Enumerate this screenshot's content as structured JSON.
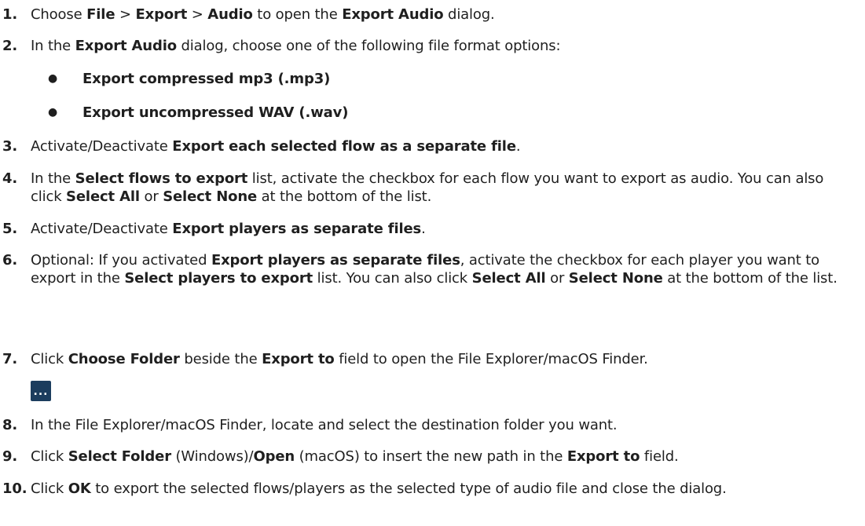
{
  "steps": [
    {
      "num": "1.",
      "segments": [
        {
          "t": "Choose "
        },
        {
          "t": "File",
          "b": true
        },
        {
          "t": " > "
        },
        {
          "t": "Export",
          "b": true
        },
        {
          "t": " > "
        },
        {
          "t": "Audio",
          "b": true
        },
        {
          "t": " to open the "
        },
        {
          "t": "Export Audio",
          "b": true
        },
        {
          "t": " dialog."
        }
      ]
    },
    {
      "num": "2.",
      "segments": [
        {
          "t": "In the "
        },
        {
          "t": "Export Audio",
          "b": true
        },
        {
          "t": " dialog, choose one of the following file format options:"
        }
      ]
    },
    {
      "num": "3.",
      "segments": [
        {
          "t": "Activate/Deactivate "
        },
        {
          "t": "Export each selected flow as a separate file",
          "b": true
        },
        {
          "t": "."
        }
      ]
    },
    {
      "num": "4.",
      "segments": [
        {
          "t": "In the "
        },
        {
          "t": "Select flows to export",
          "b": true
        },
        {
          "t": " list, activate the checkbox for each flow you want to export as audio. You can also click "
        },
        {
          "t": "Select All",
          "b": true
        },
        {
          "t": " or "
        },
        {
          "t": "Select None",
          "b": true
        },
        {
          "t": " at the bottom of the list."
        }
      ]
    },
    {
      "num": "5.",
      "segments": [
        {
          "t": "Activate/Deactivate "
        },
        {
          "t": "Export players as separate files",
          "b": true
        },
        {
          "t": "."
        }
      ]
    },
    {
      "num": "6.",
      "segments": [
        {
          "t": "Optional: If you activated "
        },
        {
          "t": "Export players as separate files",
          "b": true
        },
        {
          "t": ", activate the checkbox for each player you want to export in the "
        },
        {
          "t": "Select players to export",
          "b": true
        },
        {
          "t": " list. You can also click "
        },
        {
          "t": "Select All",
          "b": true
        },
        {
          "t": " or "
        },
        {
          "t": "Select None",
          "b": true
        },
        {
          "t": " at the bottom of the list."
        }
      ]
    },
    {
      "num": "7.",
      "segments": [
        {
          "t": "Click "
        },
        {
          "t": "Choose Folder",
          "b": true
        },
        {
          "t": " beside the "
        },
        {
          "t": "Export to",
          "b": true
        },
        {
          "t": " field to open the File Explorer/macOS Finder."
        }
      ]
    },
    {
      "num": "8.",
      "segments": [
        {
          "t": "In the File Explorer/macOS Finder, locate and select the destination folder you want."
        }
      ]
    },
    {
      "num": "9.",
      "segments": [
        {
          "t": "Click "
        },
        {
          "t": "Select Folder",
          "b": true
        },
        {
          "t": " (Windows)/"
        },
        {
          "t": "Open",
          "b": true
        },
        {
          "t": " (macOS) to insert the new path in the "
        },
        {
          "t": "Export to",
          "b": true
        },
        {
          "t": " field."
        }
      ]
    },
    {
      "num": "10.",
      "segments": [
        {
          "t": "Click "
        },
        {
          "t": "OK",
          "b": true
        },
        {
          "t": " to export the selected flows/players as the selected type of audio file and close the dialog."
        }
      ]
    }
  ],
  "bullets": [
    {
      "marker": "●",
      "label": "Export compressed mp3 (.mp3)"
    },
    {
      "marker": "●",
      "label": "Export uncompressed WAV (.wav)"
    }
  ],
  "choose_folder_icon": {
    "label": "...",
    "icon": "ellipsis-icon",
    "color": "#1c3d5e"
  }
}
